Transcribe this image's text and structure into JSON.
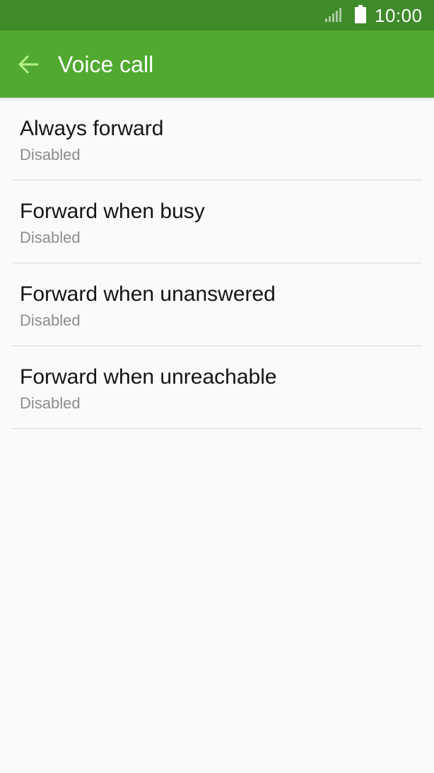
{
  "status_bar": {
    "time": "10:00",
    "signal_icon": "signal-bars-icon",
    "battery_icon": "battery-full-icon"
  },
  "app_bar": {
    "back_icon": "arrow-back-icon",
    "title": "Voice call",
    "bar_color": "#51a931",
    "status_color": "#3f8a2a",
    "accent_color": "#b7f08a"
  },
  "settings": [
    {
      "title": "Always forward",
      "status": "Disabled"
    },
    {
      "title": "Forward when busy",
      "status": "Disabled"
    },
    {
      "title": "Forward when unanswered",
      "status": "Disabled"
    },
    {
      "title": "Forward when unreachable",
      "status": "Disabled"
    }
  ]
}
